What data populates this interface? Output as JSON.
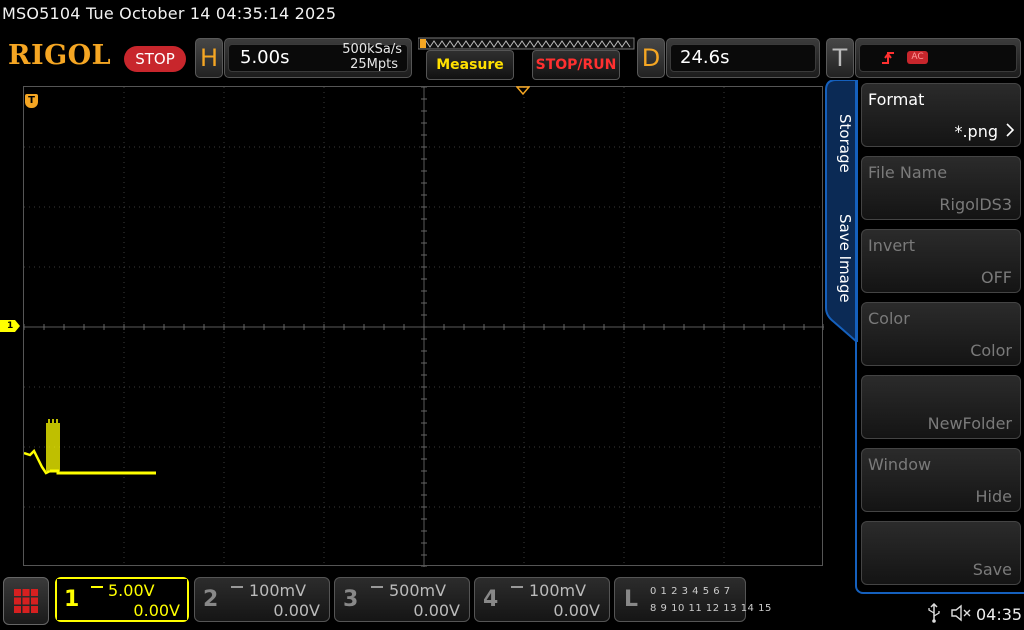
{
  "status_line": "MSO5104  Tue October 14 04:35:14 2025",
  "brand": {
    "logo": "RIGOL",
    "run_state": "STOP"
  },
  "horizontal": {
    "letter": "H",
    "timebase": "5.00s",
    "sample_rate": "500kSa/s",
    "memory_depth": "25Mpts"
  },
  "buttons": {
    "measure": "Measure",
    "stop_run": "STOP/RUN"
  },
  "delay": {
    "letter": "D",
    "value": "24.6s"
  },
  "trigger": {
    "letter": "T",
    "mode": "AC"
  },
  "side_menu": {
    "tabs": [
      "Storage",
      "Save Image"
    ],
    "items": [
      {
        "title": "Format",
        "value": "*.png",
        "active": true
      },
      {
        "title": "File Name",
        "value": "RigolDS3",
        "active": false
      },
      {
        "title": "Invert",
        "value": "OFF",
        "active": false
      },
      {
        "title": "Color",
        "value": "Color",
        "active": false
      },
      {
        "title": "",
        "value": "NewFolder",
        "active": false
      },
      {
        "title": "Window",
        "value": "Hide",
        "active": false
      },
      {
        "title": "",
        "value": "Save",
        "active": false
      }
    ]
  },
  "channels": [
    {
      "num": "1",
      "scale": "5.00V",
      "offset": "0.00V",
      "active": true
    },
    {
      "num": "2",
      "scale": "100mV",
      "offset": "0.00V",
      "active": false
    },
    {
      "num": "3",
      "scale": "500mV",
      "offset": "0.00V",
      "active": false
    },
    {
      "num": "4",
      "scale": "100mV",
      "offset": "0.00V",
      "active": false
    }
  ],
  "logic": {
    "letter": "L",
    "row1": "0 1 2 3   4 5 6 7",
    "row2": "8 9 10 11 12 13 14 15"
  },
  "markers": {
    "ch1": "1",
    "trigger": "T"
  },
  "clock": "04:35",
  "colors": {
    "ch1": "#ffff00",
    "accent": "#f5a623",
    "menu_blue": "#1560bd",
    "stop_red": "#c8262c"
  }
}
